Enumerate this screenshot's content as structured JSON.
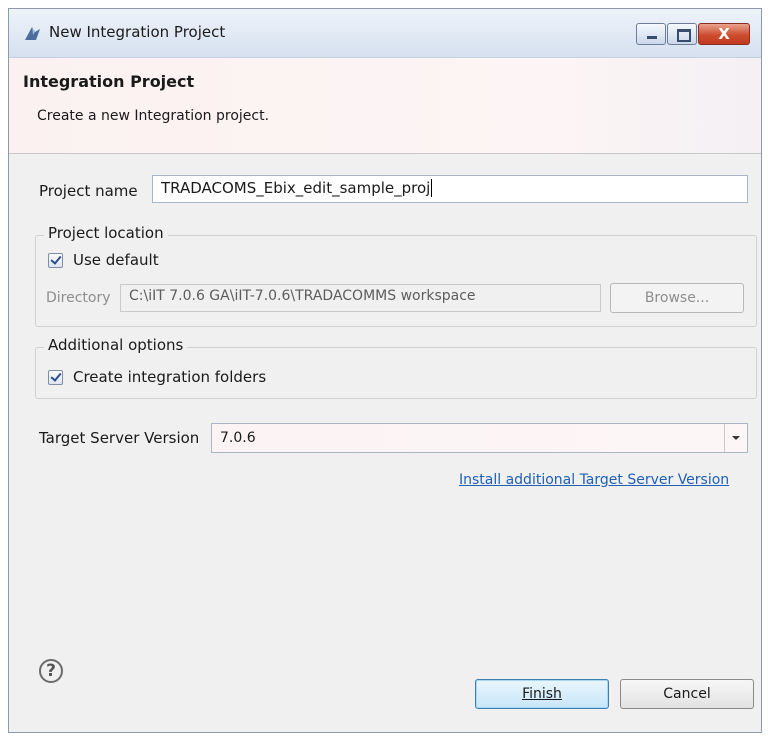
{
  "window": {
    "title": "New Integration Project",
    "controls": {
      "minimize": "minimize",
      "maximize": "maximize",
      "close": "X"
    }
  },
  "header": {
    "title": "Integration Project",
    "subtitle": "Create a new Integration project."
  },
  "form": {
    "project_name_label": "Project name",
    "project_name_value": "TRADACOMS_Ebix_edit_sample_proj",
    "location": {
      "legend": "Project location",
      "use_default_label": "Use default",
      "use_default_checked": true,
      "directory_label": "Directory",
      "directory_value": "C:\\iIT 7.0.6 GA\\iIT-7.0.6\\TRADACOMMS workspace",
      "browse_label": "Browse..."
    },
    "additional": {
      "legend": "Additional options",
      "create_folders_label": "Create integration folders",
      "create_folders_checked": true
    },
    "target_server_label": "Target Server Version",
    "target_server_value": "7.0.6",
    "install_link": "Install additional Target Server Version"
  },
  "footer": {
    "help_icon": "?",
    "finish_label": "Finish",
    "cancel_label": "Cancel"
  },
  "colors": {
    "link": "#1f5fb4",
    "header_bg": "#fbf1f1",
    "close_button": "#cd4d2f"
  }
}
